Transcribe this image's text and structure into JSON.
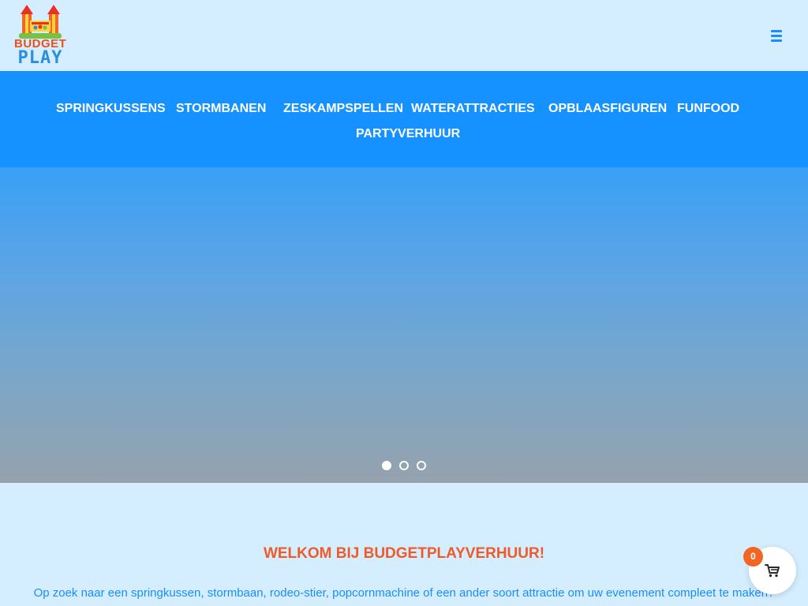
{
  "brand": {
    "line1": "BUDGET",
    "line2": "PLAY"
  },
  "nav": {
    "items": [
      {
        "label": "SPRINGKUSSENS"
      },
      {
        "label": "STORMBANEN"
      },
      {
        "label": "ZESKAMPSPELLEN"
      },
      {
        "label": "WATERATTRACTIES"
      },
      {
        "label": "OPBLAASFIGUREN"
      },
      {
        "label": "FUNFOOD"
      },
      {
        "label": "PARTYVERHUUR"
      }
    ]
  },
  "slider": {
    "slide_count": 3,
    "active_slide": 1
  },
  "content": {
    "welcome_title": "WELKOM BIJ BUDGETPLAYVERHUUR!",
    "intro_text": "Op zoek naar een springkussen, stormbaan, rodeo-stier, popcornmachine of een ander soort attractie om uw evenement compleet te maken?"
  },
  "cart": {
    "count": "0"
  },
  "colors": {
    "page_background": "#d4eeff",
    "nav_background": "#1592ff",
    "accent_orange": "#f05a28",
    "link_blue": "#1a8cff"
  }
}
